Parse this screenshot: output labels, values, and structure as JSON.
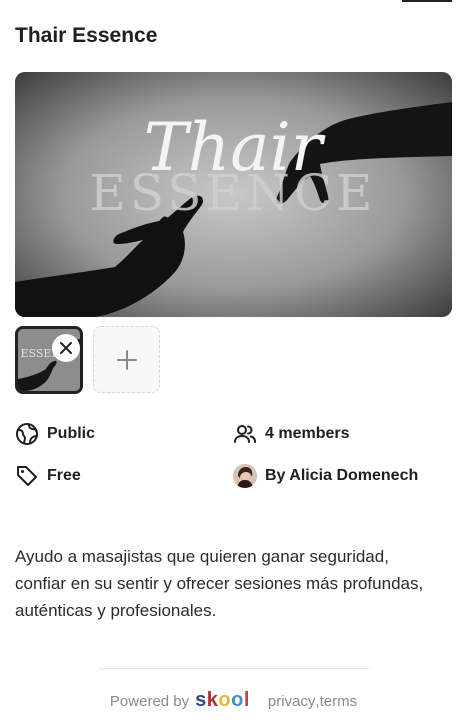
{
  "group": {
    "title": "Thair Essence",
    "cover_script_text": "Thair",
    "cover_caps_text": "ESSENCE"
  },
  "meta": {
    "visibility": "Public",
    "members": "4 members",
    "price": "Free",
    "owner": "By Alicia Domenech"
  },
  "icons": {
    "visibility": "globe-icon",
    "members": "users-icon",
    "price": "tag-icon",
    "remove": "close-icon",
    "add": "plus-icon"
  },
  "description": {
    "line1": "Ayudo a masajistas que quieren ganar seguridad,",
    "line2": "confiar en su sentir y ofrecer sesiones más profundas,",
    "line3": "auténticas y profesionales."
  },
  "footer": {
    "powered_by": "Powered by",
    "brand_letters": [
      "s",
      "k",
      "o",
      "o",
      "l"
    ],
    "privacy": "privacy",
    "separator": ", ",
    "terms": "terms"
  },
  "colors": {
    "brand_s": "#2e4881",
    "brand_k": "#b02e2e",
    "brand_o1": "#e8b73b",
    "brand_o2": "#4290c8",
    "brand_l": "#c2463a",
    "text_primary": "#1f1f1f",
    "text_muted": "#8a8a8a"
  }
}
